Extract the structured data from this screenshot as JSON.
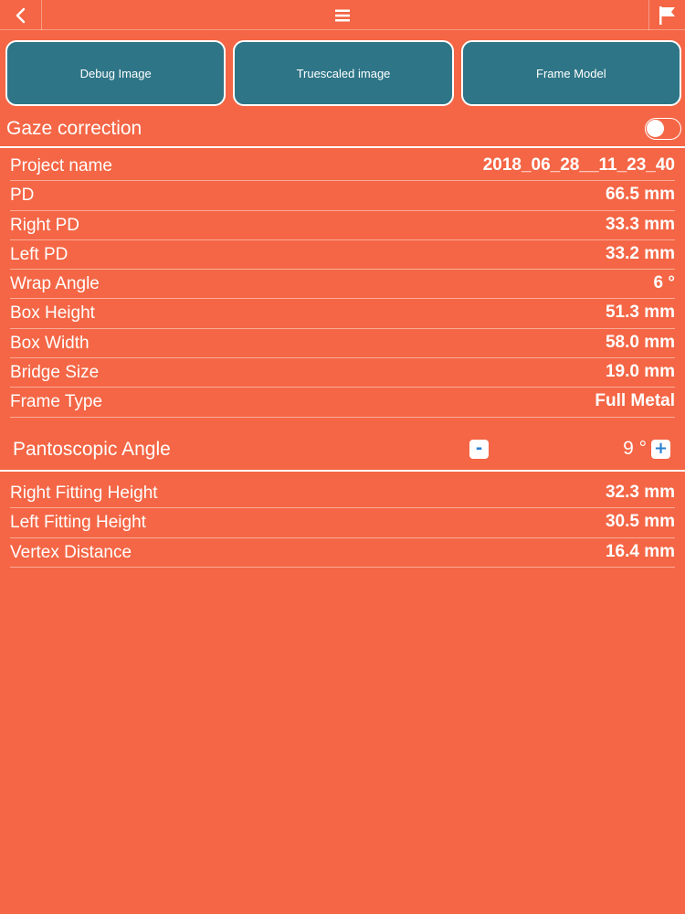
{
  "nav": {
    "back_icon": "chevron-left-icon",
    "menu_icon": "hamburger-menu-icon",
    "flag_icon": "flag-icon"
  },
  "buttons": [
    {
      "label": "Debug Image"
    },
    {
      "label": "Truescaled image"
    },
    {
      "label": "Frame Model"
    }
  ],
  "gaze": {
    "label": "Gaze correction",
    "enabled": false
  },
  "measurements": [
    {
      "label": "Project name",
      "value": "2018_06_28__11_23_40"
    },
    {
      "label": "PD",
      "value": "66.5 mm"
    },
    {
      "label": "Right PD",
      "value": "33.3 mm"
    },
    {
      "label": "Left PD",
      "value": "33.2 mm"
    },
    {
      "label": "Wrap Angle",
      "value": "6 °"
    },
    {
      "label": "Box Height",
      "value": "51.3 mm"
    },
    {
      "label": "Box Width",
      "value": "58.0 mm"
    },
    {
      "label": "Bridge Size",
      "value": "19.0 mm"
    },
    {
      "label": "Frame Type",
      "value": "Full Metal"
    }
  ],
  "pantoscopic": {
    "label": "Pantoscopic Angle",
    "value": "9 °",
    "minus_label": "-",
    "plus_label": "+"
  },
  "fitting": [
    {
      "label": "Right Fitting Height",
      "value": "32.3 mm"
    },
    {
      "label": "Left Fitting Height",
      "value": "30.5 mm"
    },
    {
      "label": "Vertex Distance",
      "value": "16.4 mm"
    }
  ],
  "colors": {
    "background": "#f46645",
    "button": "#2e7587",
    "stepper_accent": "#2a7fd0"
  }
}
